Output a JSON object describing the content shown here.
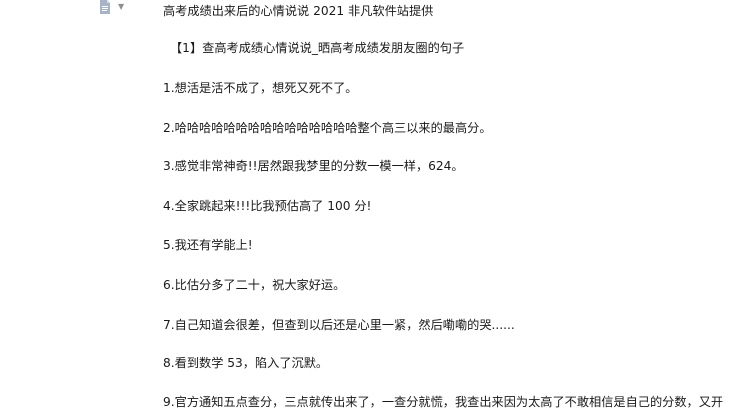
{
  "header": {
    "icon": "document-icon",
    "title": "高考成绩出来后的心情说说 2021 非凡软件站提供"
  },
  "section_heading": "【1】查高考成绩心情说说_晒高考成绩发朋友圈的句子",
  "items": [
    "1.想活是活不成了，想死又死不了。",
    "2.哈哈哈哈哈哈哈哈哈哈哈哈哈哈哈整个高三以来的最高分。",
    "3.感觉非常神奇!!居然跟我梦里的分数一模一样，624。",
    "4.全家跳起来!!!比我预估高了 100 分!",
    "5.我还有学能上!",
    "6.比估分多了二十，祝大家好运。",
    "7.自己知道会很差，但查到以后还是心里一紧，然后嘞嘞的哭......",
    "8.看到数学 53，陷入了沉默。",
    "9.官方通知五点查分，三点就传出来了，一查分就慌，我查出来因为太高了不敢相信是自己的分数，又开"
  ]
}
